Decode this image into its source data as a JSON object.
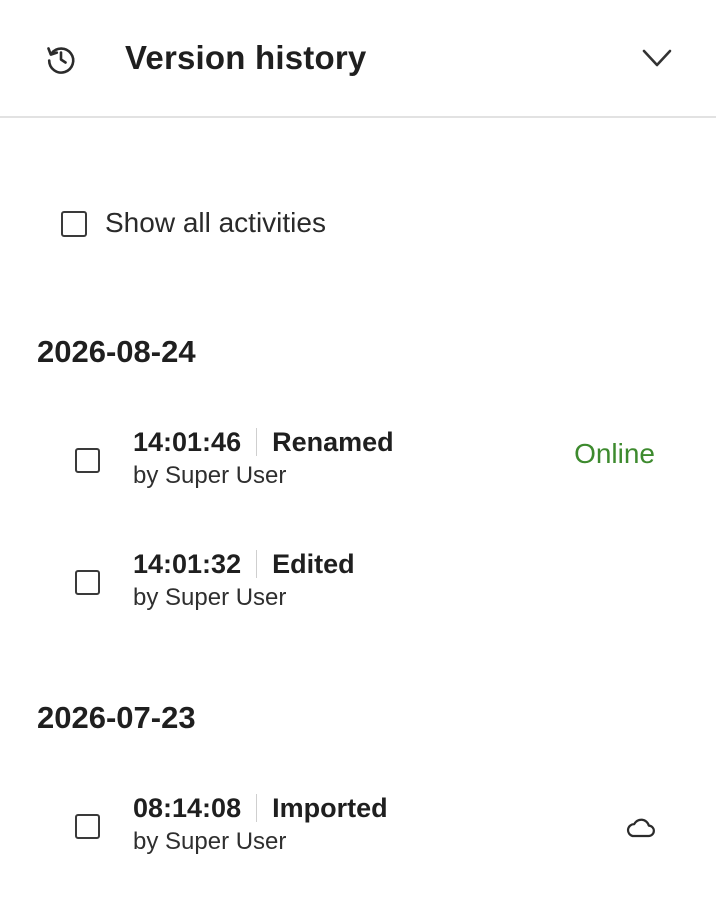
{
  "panel": {
    "title": "Version history",
    "history_icon": "history-icon",
    "collapse_icon": "chevron-down-icon"
  },
  "filter": {
    "show_all_label": "Show all activities",
    "checked": false
  },
  "groups": [
    {
      "date": "2026-08-24",
      "entries": [
        {
          "time": "14:01:46",
          "action": "Renamed",
          "by": "by Super User",
          "status": "Online",
          "status_color": "#3d8a2e"
        },
        {
          "time": "14:01:32",
          "action": "Edited",
          "by": "by Super User",
          "status": ""
        }
      ]
    },
    {
      "date": "2026-07-23",
      "entries": [
        {
          "time": "08:14:08",
          "action": "Imported",
          "by": "by Super User",
          "status": "",
          "status_icon": "cloud-icon"
        }
      ]
    }
  ]
}
